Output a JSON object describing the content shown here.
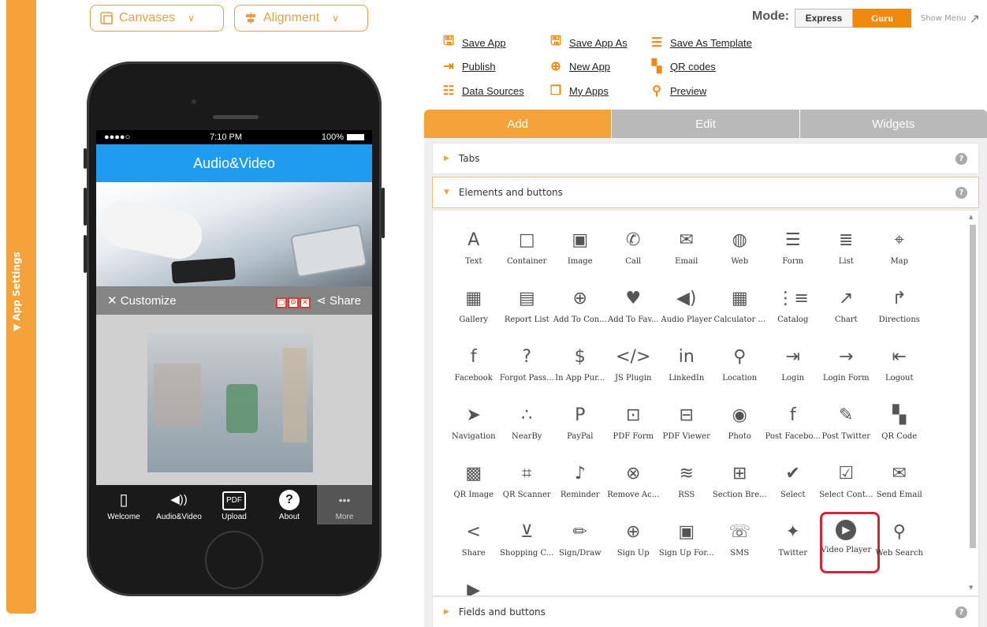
{
  "sidebar": {
    "label": "▼ App Settings"
  },
  "toolbar": {
    "canvases": "Canvases",
    "alignment": "Alignment"
  },
  "phone": {
    "status": {
      "carrier": "●●●●○",
      "time": "7:10 PM",
      "battery": "100%"
    },
    "title": "Audio&Video",
    "customize": "Customize",
    "share": "Share",
    "tabs": [
      {
        "label": "Welcome",
        "icon": "▯"
      },
      {
        "label": "Audio&Video",
        "icon": "◀))"
      },
      {
        "label": "Upload",
        "icon": "PDF"
      },
      {
        "label": "About",
        "icon": "?"
      },
      {
        "label": "More",
        "icon": "•••"
      }
    ]
  },
  "mode": {
    "label": "Mode:",
    "express": "Express",
    "guru": "Guru",
    "show_menu": "Show Menu"
  },
  "actions": {
    "save_app": "Save App",
    "save_app_as": "Save App As",
    "save_as_template": "Save As Template",
    "publish": "Publish",
    "new_app": "New App",
    "qr_codes": "QR codes",
    "data_sources": "Data Sources",
    "my_apps": "My Apps",
    "preview": "Preview"
  },
  "panel_tabs": {
    "add": "Add",
    "edit": "Edit",
    "widgets": "Widgets"
  },
  "sections": {
    "tabs": "Tabs",
    "elements": "Elements and buttons",
    "fields": "Fields and buttons",
    "help": "?"
  },
  "elements": [
    {
      "label": "Text",
      "icon": "A"
    },
    {
      "label": "Container",
      "icon": "□"
    },
    {
      "label": "Image",
      "icon": "▣"
    },
    {
      "label": "Call",
      "icon": "✆"
    },
    {
      "label": "Email",
      "icon": "✉"
    },
    {
      "label": "Web",
      "icon": "◍"
    },
    {
      "label": "Form",
      "icon": "☰"
    },
    {
      "label": "List",
      "icon": "≣"
    },
    {
      "label": "Map",
      "icon": "⌖"
    },
    {
      "label": "Gallery",
      "icon": "▦"
    },
    {
      "label": "Report List",
      "icon": "▤"
    },
    {
      "label": "Add To Con...",
      "icon": "⊕"
    },
    {
      "label": "Add To Fav...",
      "icon": "♥"
    },
    {
      "label": "Audio Player",
      "icon": "◀)"
    },
    {
      "label": "Calculator ...",
      "icon": "▦"
    },
    {
      "label": "Catalog",
      "icon": "⋮≡"
    },
    {
      "label": "Chart",
      "icon": "↗"
    },
    {
      "label": "Directions",
      "icon": "↱"
    },
    {
      "label": "Facebook",
      "icon": "f"
    },
    {
      "label": "Forgot Pass...",
      "icon": "?"
    },
    {
      "label": "In App Pur...",
      "icon": "$"
    },
    {
      "label": "JS Plugin",
      "icon": "</>"
    },
    {
      "label": "LinkedIn",
      "icon": "in"
    },
    {
      "label": "Location",
      "icon": "⚲"
    },
    {
      "label": "Login",
      "icon": "⇥"
    },
    {
      "label": "Login Form",
      "icon": "→"
    },
    {
      "label": "Logout",
      "icon": "⇤"
    },
    {
      "label": "Navigation",
      "icon": "➤"
    },
    {
      "label": "NearBy",
      "icon": "∴"
    },
    {
      "label": "PayPal",
      "icon": "P"
    },
    {
      "label": "PDF Form",
      "icon": "⊡"
    },
    {
      "label": "PDF Viewer",
      "icon": "⊟"
    },
    {
      "label": "Photo",
      "icon": "◉"
    },
    {
      "label": "Post Facebo...",
      "icon": "f"
    },
    {
      "label": "Post Twitter",
      "icon": "✎"
    },
    {
      "label": "QR Code",
      "icon": "▚"
    },
    {
      "label": "QR Image",
      "icon": "▩"
    },
    {
      "label": "QR Scanner",
      "icon": "⌗"
    },
    {
      "label": "Reminder",
      "icon": "♪"
    },
    {
      "label": "Remove Ac...",
      "icon": "⊗"
    },
    {
      "label": "RSS",
      "icon": "≋"
    },
    {
      "label": "Section Bre...",
      "icon": "⊞"
    },
    {
      "label": "Select",
      "icon": "✔"
    },
    {
      "label": "Select Cont...",
      "icon": "☑"
    },
    {
      "label": "Send Email",
      "icon": "✉"
    },
    {
      "label": "Share",
      "icon": "<"
    },
    {
      "label": "Shopping C...",
      "icon": "⊻"
    },
    {
      "label": "Sign/Draw",
      "icon": "✏"
    },
    {
      "label": "Sign Up",
      "icon": "⊕"
    },
    {
      "label": "Sign Up For...",
      "icon": "▣"
    },
    {
      "label": "SMS",
      "icon": "☏"
    },
    {
      "label": "Twitter",
      "icon": "✦"
    },
    {
      "label": "Video Player",
      "icon": "▶"
    },
    {
      "label": "Web Search",
      "icon": "⚲"
    },
    {
      "label": "",
      "icon": "▶"
    }
  ],
  "highlighted": "Video Player",
  "colors": {
    "accent": "#f3a33a",
    "guru": "#f08a0c",
    "highlight": "#d0263a",
    "phone_title": "#1f9bf0"
  }
}
